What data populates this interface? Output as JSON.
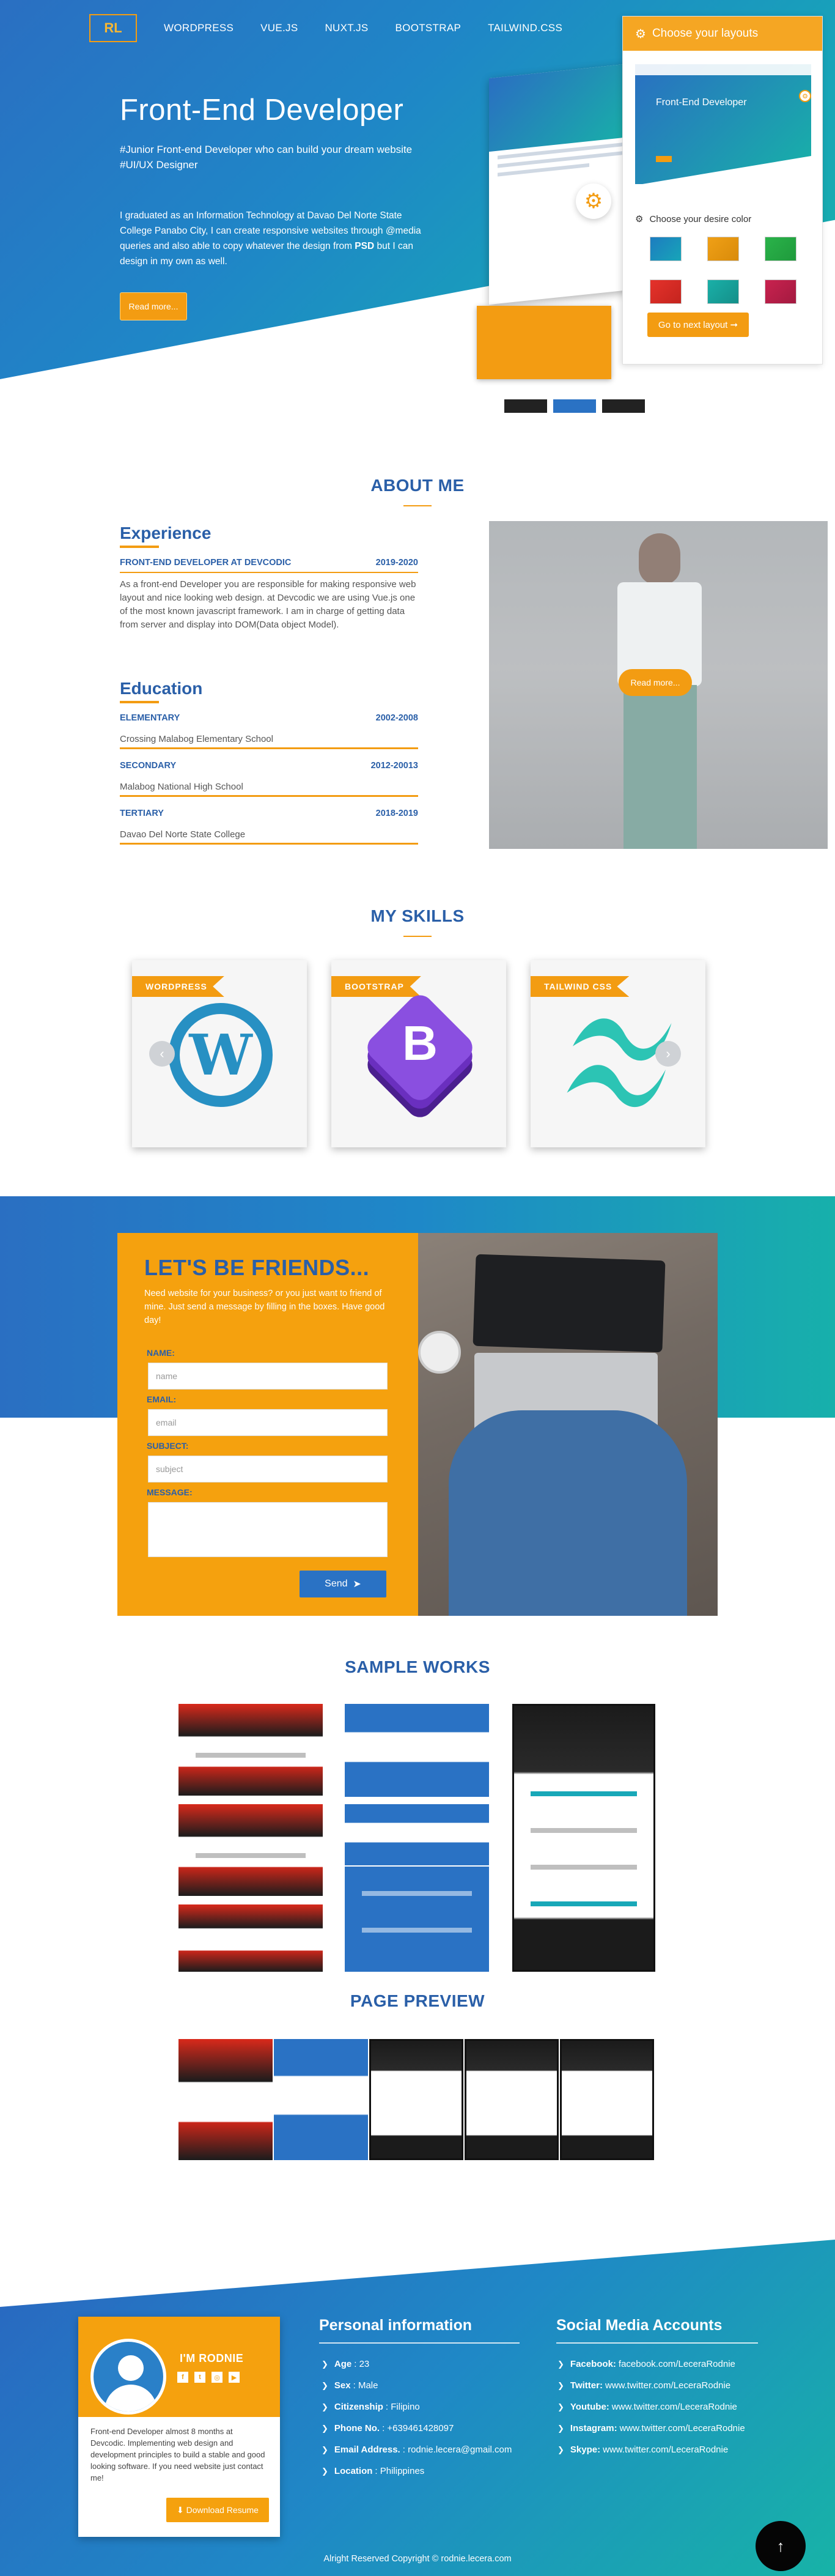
{
  "nav": {
    "logo": "RL",
    "links": [
      "WORDPRESS",
      "VUE.JS",
      "NUXT.JS",
      "BOOTSTRAP",
      "TAILWIND.CSS"
    ]
  },
  "hero": {
    "title": "Front-End Developer",
    "tagline": "#Junior Front-end Developer who can build your dream website #UI/UX Designer",
    "description_pre": "I graduated as an Information Technology at Davao Del Norte State College Panabo City, I can create responsive websites through @media queries and also able to copy whatever the design from ",
    "description_bold": "PSD",
    "description_post": " but I can design in my own as well.",
    "button": "Read more..."
  },
  "layouts_panel": {
    "title": "Choose your layouts",
    "preview_title": "Front-End Developer",
    "color_label": "Choose your desire color",
    "swatches": [
      "#1d7cc0",
      "#f0a016",
      "#2ab34a",
      "#e5322b",
      "#1ab0a8",
      "#c9224f"
    ],
    "next_button": "Go to next layout"
  },
  "about": {
    "title": "ABOUT ME",
    "experience_heading": "Experience",
    "experience": {
      "role": "FRONT-END DEVELOPER AT DEVCODIC",
      "years": "2019-2020",
      "text": "As a front-end Developer you are responsible for making responsive web layout and nice looking web design. at Devcodic we are using Vue.js one of the most known javascript framework. I am in charge of getting data from server and display into DOM(Data object Model)."
    },
    "education_heading": "Education",
    "education": [
      {
        "level": "ELEMENTARY",
        "years": "2002-2008",
        "school": "Crossing Malabog Elementary School"
      },
      {
        "level": "SECONDARY",
        "years": "2012-20013",
        "school": "Malabog National High School"
      },
      {
        "level": "TERTIARY",
        "years": "2018-2019",
        "school": "Davao Del Norte State College"
      }
    ],
    "photo_button": "Read more..."
  },
  "skills": {
    "title": "MY SKILLS",
    "items": [
      "WORDPRESS",
      "BOOTSTRAP",
      "TAILWIND CSS"
    ]
  },
  "contact": {
    "title": "LET'S BE FRIENDS...",
    "description": "Need website for your business? or you just want to friend of mine. Just send a message by filling in the boxes. Have good day!",
    "name_label": "NAME:",
    "name_placeholder": "name",
    "email_label": "EMAIL:",
    "email_placeholder": "email",
    "subject_label": "SUBJECT:",
    "subject_placeholder": "subject",
    "message_label": "MESSAGE:",
    "send_button": "Send"
  },
  "works": {
    "title": "SAMPLE WORKS"
  },
  "preview": {
    "title": "PAGE PREVIEW"
  },
  "footer": {
    "name": "I'M RODNIE",
    "bio": "Front-end Developer almost 8 months at Devcodic. Implementing web design and development principles to build a stable and good looking software. If you need website just contact me!",
    "download_button": "Download Resume",
    "personal_heading": "Personal information",
    "personal": [
      {
        "label": "Age",
        "value": ": 23"
      },
      {
        "label": "Sex",
        "value": ": Male"
      },
      {
        "label": "Citizenship",
        "value": ": Filipino"
      },
      {
        "label": "Phone No.",
        "value": ": +639461428097"
      },
      {
        "label": "Email Address.",
        "value": ": rodnie.lecera@gmail.com"
      },
      {
        "label": "Location",
        "value": ": Philippines"
      }
    ],
    "social_heading": "Social Media Accounts",
    "social": [
      {
        "label": "Facebook:",
        "value": "facebook.com/LeceraRodnie"
      },
      {
        "label": "Twitter:",
        "value": "www.twitter.com/LeceraRodnie"
      },
      {
        "label": "Youtube:",
        "value": "www.twitter.com/LeceraRodnie"
      },
      {
        "label": "Instagram:",
        "value": "www.twitter.com/LeceraRodnie"
      },
      {
        "label": "Skype:",
        "value": "www.twitter.com/LeceraRodnie"
      }
    ],
    "copyright": "Alright Reserved Copyright © rodnie.lecera.com"
  }
}
